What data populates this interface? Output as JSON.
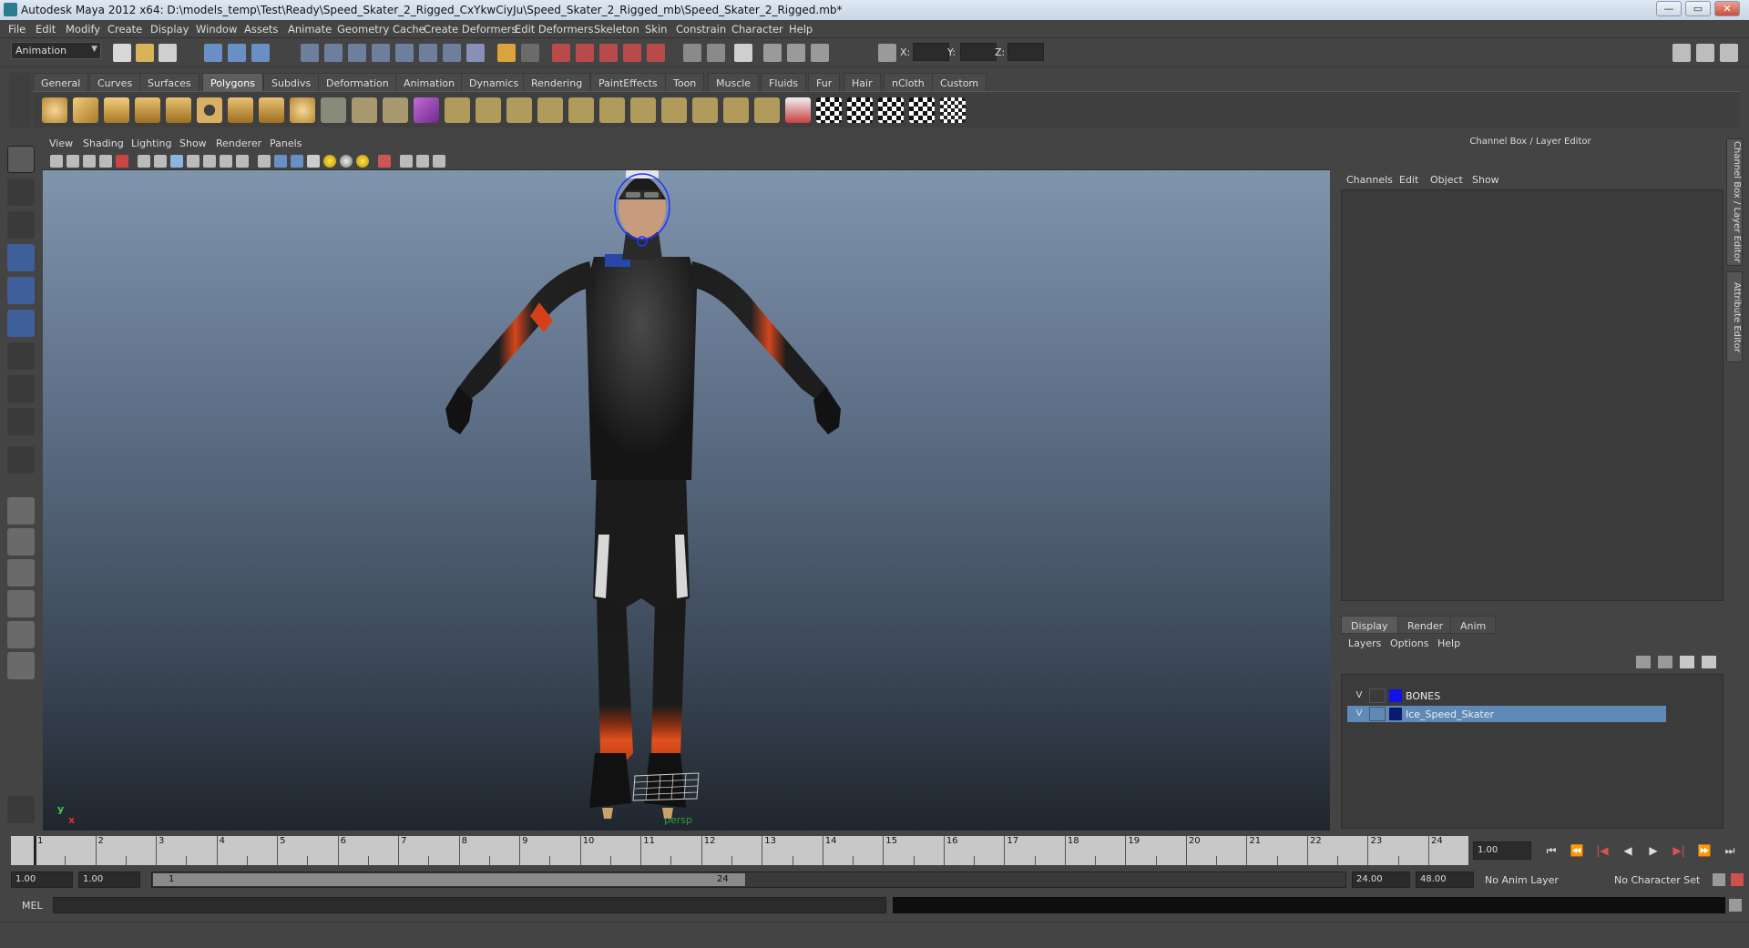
{
  "window": {
    "title": "Autodesk Maya 2012 x64: D:\\models_temp\\Test\\Ready\\Speed_Skater_2_Rigged_CxYkwCiyJu\\Speed_Skater_2_Rigged_mb\\Speed_Skater_2_Rigged.mb*",
    "minimize": "—",
    "maximize": "▭",
    "close": "✕"
  },
  "menu": [
    "File",
    "Edit",
    "Modify",
    "Create",
    "Display",
    "Window",
    "Assets",
    "Animate",
    "Geometry Cache",
    "Create Deformers",
    "Edit Deformers",
    "Skeleton",
    "Skin",
    "Constrain",
    "Character",
    "Help"
  ],
  "status_line": {
    "mode": "Animation",
    "x_label": "X:",
    "y_label": "Y:",
    "z_label": "Z:"
  },
  "shelf_tabs": [
    "General",
    "Curves",
    "Surfaces",
    "Polygons",
    "Subdivs",
    "Deformation",
    "Animation",
    "Dynamics",
    "Rendering",
    "PaintEffects",
    "Toon",
    "Muscle",
    "Fluids",
    "Fur",
    "Hair",
    "nCloth",
    "Custom"
  ],
  "active_shelf_tab": "Polygons",
  "viewport": {
    "menu": [
      "View",
      "Shading",
      "Lighting",
      "Show",
      "Renderer",
      "Panels"
    ],
    "camera": "persp",
    "axis_y": "y",
    "axis_x": "x"
  },
  "channel_box": {
    "title": "Channel Box / Layer Editor",
    "menu": [
      "Channels",
      "Edit",
      "Object",
      "Show"
    ]
  },
  "layer_editor": {
    "tabs": [
      "Display",
      "Render",
      "Anim"
    ],
    "menu": [
      "Layers",
      "Options",
      "Help"
    ],
    "layers": [
      {
        "visible": "V",
        "name": "BONES",
        "color": "#1212e6"
      },
      {
        "visible": "V",
        "name": "Ice_Speed_Skater",
        "color": "#0b1a6e"
      }
    ]
  },
  "side_tabs": [
    "Channel Box / Layer Editor",
    "Attribute Editor"
  ],
  "time_slider": {
    "ticks": [
      "1",
      "2",
      "3",
      "4",
      "5",
      "6",
      "7",
      "8",
      "9",
      "10",
      "11",
      "12",
      "13",
      "14",
      "15",
      "16",
      "17",
      "18",
      "19",
      "20",
      "21",
      "22",
      "23",
      "24"
    ],
    "current_frame": "1.00"
  },
  "playback": [
    "⏮",
    "⏪",
    "|◀",
    "◀",
    "▶",
    "▶|",
    "⏩",
    "⏭"
  ],
  "range": {
    "start": "1.00",
    "playback_start": "1.00",
    "slider_start": "1",
    "slider_end": "24",
    "playback_end": "24.00",
    "end": "48.00",
    "anim_layer": "No Anim Layer",
    "character_set": "No Character Set"
  },
  "command_line": {
    "label": "MEL"
  },
  "colors": {
    "ui_bg": "#444444",
    "selection": "#5f8ab8",
    "camera_label": "#2f9a3a"
  }
}
